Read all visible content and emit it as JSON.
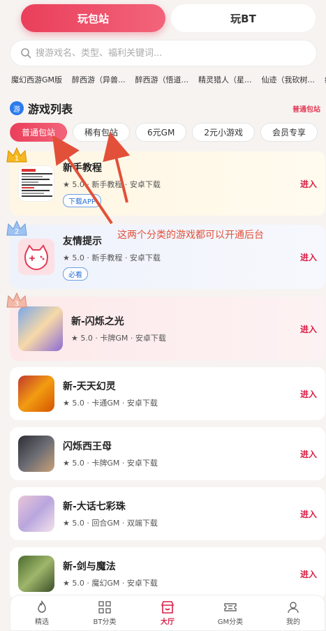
{
  "top_tabs": [
    "玩包站",
    "玩BT"
  ],
  "search": {
    "placeholder": "搜游戏名、类型、福利关键词..."
  },
  "recent_games": [
    "魔幻西游GM版",
    "醉西游（异兽...",
    "醉西游（悟道...",
    "精灵猎人（星...",
    "仙迹（我砍树...",
    "绯"
  ],
  "section": {
    "title": "游戏列表",
    "icon_text": "游",
    "right_label": "普通包站"
  },
  "filters": [
    "普通包站",
    "稀有包站",
    "6元GM",
    "2元小游戏",
    "会员专享"
  ],
  "annotation": "这两个分类的游戏都可以开通后台",
  "games": [
    {
      "name": "新手教程",
      "meta": "★ 5.0 · 新手教程 · 安卓下载",
      "tag": "下载APP",
      "rank": "1",
      "enter": "进入"
    },
    {
      "name": "友情提示",
      "meta": "★ 5.0 · 新手教程 · 安卓下载",
      "tag": "必看",
      "rank": "2",
      "enter": "进入"
    },
    {
      "name": "新-闪烁之光",
      "meta": "★ 5.0 · 卡牌GM · 安卓下载",
      "rank": "3",
      "enter": "进入"
    },
    {
      "name": "新-天天幻灵",
      "meta": "★ 5.0 · 卡通GM · 安卓下载",
      "enter": "进入"
    },
    {
      "name": "闪烁西王母",
      "meta": "★ 5.0 · 卡牌GM · 安卓下载",
      "enter": "进入"
    },
    {
      "name": "新-大话七彩珠",
      "meta": "★ 5.0 · 回合GM · 双端下载",
      "enter": "进入"
    },
    {
      "name": "新-剑与魔法",
      "meta": "★ 5.0 · 魔幻GM · 安卓下载",
      "enter": "进入"
    }
  ],
  "bottom_nav": [
    "精选",
    "BT分类",
    "大厅",
    "GM分类",
    "我的"
  ],
  "colors": {
    "accent": "#e23c57",
    "tag_blue": "#2a6fd6",
    "annotation": "#e2503a"
  }
}
